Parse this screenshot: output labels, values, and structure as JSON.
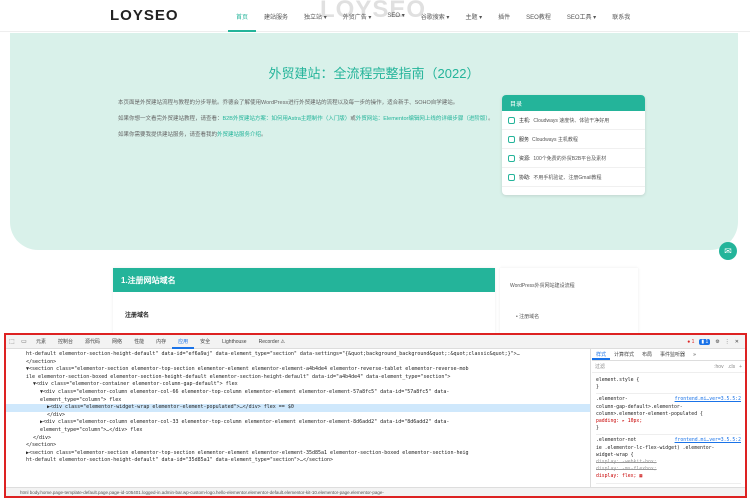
{
  "site": {
    "logo": "LOYSEO",
    "logo_ghost": "LOYSEO",
    "nav": [
      "首页",
      "建站服务",
      "独立站 ▾",
      "外贸广告 ▾",
      "SEO ▾",
      "谷歌搜索 ▾",
      "主题 ▾",
      "插件",
      "SEO教程",
      "SEO工具 ▾",
      "联系我"
    ]
  },
  "hero": {
    "title": "外贸建站：全流程完整指南（2022）",
    "para1": "本页面是外贸建站流程与教程的分步导航。乔德会了解使用WordPress进行外贸建站的流程以及每一步的操作，适合新手、SOHO自学建站。",
    "para2_a": "如果你想一文看完外贸建站教程，请查看：",
    "para2_link1": "B2B外贸建站方案：如何用Astra主题制作（入门版）",
    "para2_b": "或",
    "para2_link2": "外贸网站：Elementor编辑网上线的详细步骤（进阶版）",
    "para2_c": "。",
    "para3_a": "如果你需要我提供建站服务，请查看我的",
    "para3_link": "外贸建站服务介绍",
    "para3_b": "。"
  },
  "toc": {
    "title": "目录",
    "rows": [
      {
        "key": "主机:",
        "text": "Cloudways 速度快、体验干净好用"
      },
      {
        "key": "服务",
        "text": "Cloudways 主机教程"
      },
      {
        "key": "资源:",
        "text": "100个免费的外贸B2B平台及素材"
      },
      {
        "key": "协助:",
        "text": "不用手机验证、注册Gmail教程"
      }
    ]
  },
  "article": {
    "bar": "1.注册网站域名",
    "sub": "注册域名",
    "side_1": "WordPress外贸网站建设流程",
    "side_2": "• 注册域名"
  },
  "devtools": {
    "tabs": [
      "元素",
      "控制台",
      "源代码",
      "网络",
      "性能",
      "内存",
      "应用",
      "安全",
      "Lighthouse",
      "Recorder ⚠"
    ],
    "active_tab": "应用",
    "error_count": "● 1",
    "info_count": "▮ 1",
    "dom_lines": [
      {
        "indent": 0,
        "html": "ht-default elementor-section-height-default\" data-id=\"ef6a9aj\" data-element_type=\"section\" data-settings=\"{&quot;background_background&quot;:&quot;classic&quot;}\">…"
      },
      {
        "indent": 0,
        "html": "</section>"
      },
      {
        "indent": 0,
        "html": "▼<section class=\"elementor-section elementor-top-section elementor-element elementor-element-a4b4de4 elementor-reverse-tablet elementor-reverse-mob"
      },
      {
        "indent": 0,
        "html": "ile elementor-section-boxed elementor-section-height-default elementor-section-height-default\" data-id=\"a4b4de4\" data-element_type=\"section\">"
      },
      {
        "indent": 1,
        "html": "▼<div class=\"elementor-container elementor-column-gap-default\"> flex"
      },
      {
        "indent": 2,
        "html": "▼<div class=\"elementor-column elementor-col-66 elementor-top-column elementor-element elementor-element-57a8fc5\" data-id=\"57a8fc5\" data-"
      },
      {
        "indent": 2,
        "html": "element_type=\"column\"> flex"
      },
      {
        "indent": 3,
        "html": "▶<div class=\"elementor-widget-wrap elementor-element-populated\">…</div> flex == $0"
      },
      {
        "indent": 3,
        "html": "</div>"
      },
      {
        "indent": 2,
        "html": "▶<div class=\"elementor-column elementor-col-33 elementor-top-column elementor-element elementor-element-8d6add2\" data-id=\"8d6add2\" data-"
      },
      {
        "indent": 2,
        "html": "element_type=\"column\">…</div> flex"
      },
      {
        "indent": 1,
        "html": "</div>"
      },
      {
        "indent": 0,
        "html": "</section>"
      },
      {
        "indent": 0,
        "html": "▶<section class=\"elementor-section elementor-top-section elementor-element elementor-element-35d85a1 elementor-section-boxed elementor-section-heig"
      },
      {
        "indent": 0,
        "html": "ht-default elementor-section-height-default\" data-id=\"35d85a1\" data-element_type=\"section\">…</section>"
      }
    ],
    "selected_line": 7,
    "crumbs": "html   body.home.page-template-default.page.page-id-105401.logged-in.admin-bar.wp-custom-logo.hello-elementor.elementor-default.elementor-kit-10.elementor-page.elementor-page-",
    "styles": {
      "tabs": [
        "样式",
        "计算样式",
        "布局",
        "事件监听器",
        "»"
      ],
      "active": "样式",
      "filter": "过滤",
      "filter_hov": ":hov",
      "filter_cls": ".cls",
      "rules": [
        {
          "selector": "element.style {",
          "src": "",
          "props": [],
          "close": "}"
        },
        {
          "selector": ".elementor-",
          "src": "frontend.mi…ver=3.5.5:2",
          "props": [
            "column-gap-default>.elementor-",
            "column>.elementor-element-populated {",
            "  padding: ▸ 10px;"
          ],
          "close": "}"
        },
        {
          "selector": ".elementor-not",
          "src": "frontend.mi…ver=3.5.5:2",
          "props": [
            "ie .elementor-lc-flex-widget) .elementor-",
            "widget-wrap {",
            "  display: -webkit-box;",
            "  display: -ms-flexbox;",
            "  display: flex; ▦"
          ],
          "close": ""
        }
      ]
    }
  },
  "colors": {
    "accent": "#24b49a",
    "hero_bg": "#d9f1ea",
    "devtools_border": "#dd2222",
    "link_blue": "#1a73e8"
  },
  "icons": {
    "chat": "chat-bubble-icon"
  }
}
